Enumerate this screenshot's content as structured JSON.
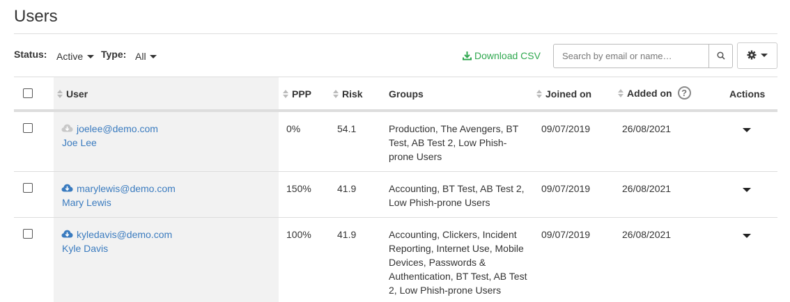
{
  "page": {
    "title": "Users"
  },
  "filters": {
    "status_label": "Status:",
    "status_value": "Active",
    "type_label": "Type:",
    "type_value": "All"
  },
  "toolbar": {
    "download_label": "Download CSV",
    "search_placeholder": "Search by email or name…",
    "colors": {
      "download": "#2fa84f",
      "link": "#3a7bbf"
    }
  },
  "table": {
    "headers": {
      "user": "User",
      "ppp": "PPP",
      "risk": "Risk",
      "groups": "Groups",
      "joined": "Joined on",
      "added": "Added on",
      "actions": "Actions"
    },
    "help_symbol": "?",
    "rows": [
      {
        "email": "joelee@demo.com",
        "name": "Joe Lee",
        "ppp": "0%",
        "risk": "54.1",
        "groups": "Production, The Avengers, BT Test, AB Test 2, Low Phish-prone Users",
        "joined": "09/07/2019",
        "added": "26/08/2021",
        "icon": "cloud-download-icon-muted"
      },
      {
        "email": "marylewis@demo.com",
        "name": "Mary Lewis",
        "ppp": "150%",
        "risk": "41.9",
        "groups": "Accounting, BT Test, AB Test 2, Low Phish-prone Users",
        "joined": "09/07/2019",
        "added": "26/08/2021",
        "icon": "cloud-download-icon"
      },
      {
        "email": "kyledavis@demo.com",
        "name": "Kyle Davis",
        "ppp": "100%",
        "risk": "41.9",
        "groups": "Accounting, Clickers, Incident Reporting, Internet Use, Mobile Devices, Passwords & Authentication, BT Test, AB Test 2, Low Phish-prone Users",
        "joined": "09/07/2019",
        "added": "26/08/2021",
        "icon": "cloud-download-icon"
      }
    ]
  }
}
